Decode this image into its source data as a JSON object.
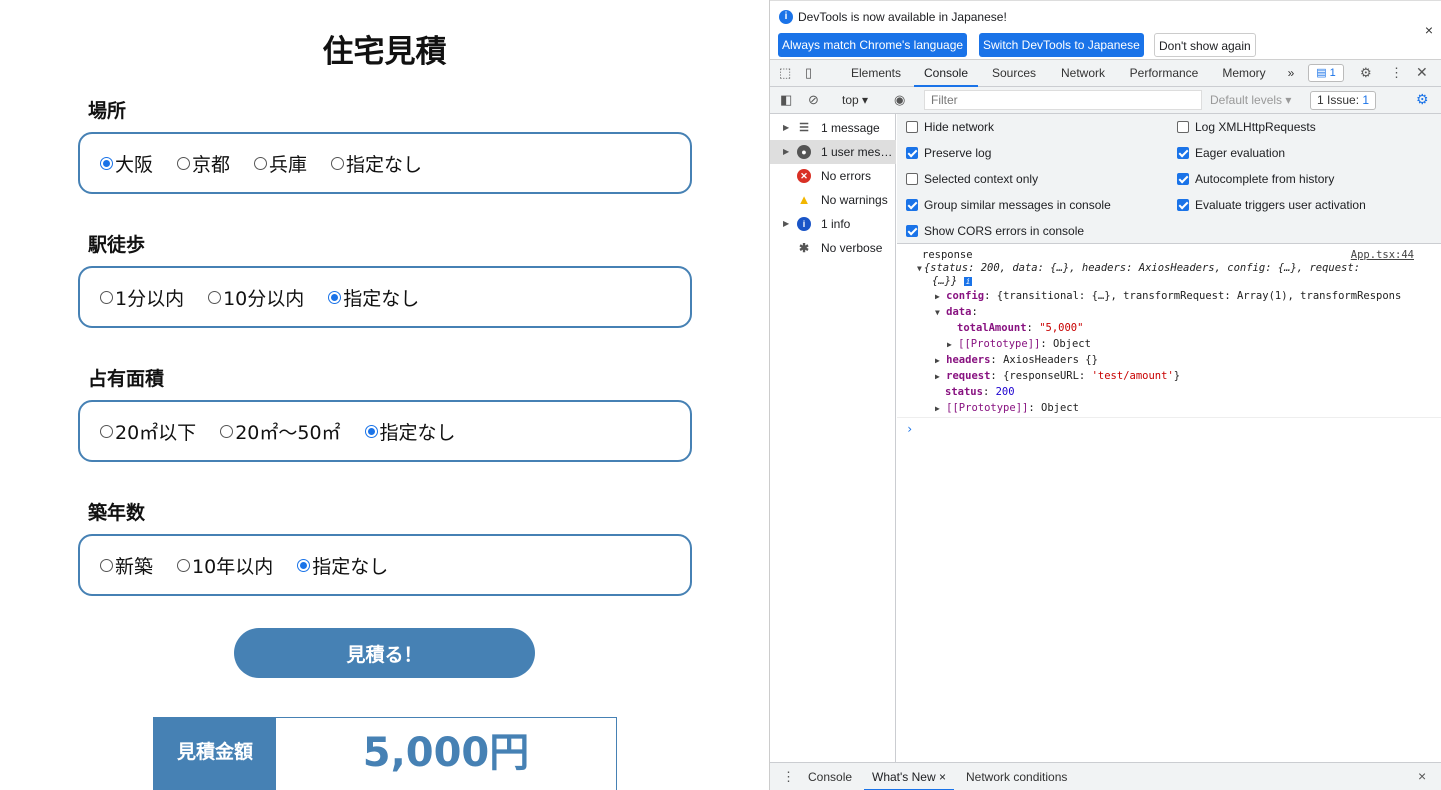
{
  "app": {
    "title": "住宅見積",
    "sections": [
      {
        "label": "場所",
        "options": [
          {
            "label": "大阪",
            "checked": true
          },
          {
            "label": "京都",
            "checked": false
          },
          {
            "label": "兵庫",
            "checked": false
          },
          {
            "label": "指定なし",
            "checked": false
          }
        ]
      },
      {
        "label": "駅徒歩",
        "options": [
          {
            "label": "1分以内",
            "checked": false
          },
          {
            "label": "10分以内",
            "checked": false
          },
          {
            "label": "指定なし",
            "checked": true
          }
        ]
      },
      {
        "label": "占有面積",
        "options": [
          {
            "label": "20㎡以下",
            "checked": false
          },
          {
            "label": "20㎡〜50㎡",
            "checked": false
          },
          {
            "label": "指定なし",
            "checked": true
          }
        ]
      },
      {
        "label": "築年数",
        "options": [
          {
            "label": "新築",
            "checked": false
          },
          {
            "label": "10年以内",
            "checked": false
          },
          {
            "label": "指定なし",
            "checked": true
          }
        ]
      }
    ],
    "estimate_button": "見積る！",
    "result_label": "見積金額",
    "result_value": "5,000円",
    "accent_color": "#4681b4"
  },
  "devtools": {
    "infobar": {
      "text": "DevTools is now available in Japanese!",
      "btn_match": "Always match Chrome's language",
      "btn_switch": "Switch DevTools to Japanese",
      "btn_dismiss": "Don't show again",
      "close": "×"
    },
    "tabs": [
      "Elements",
      "Console",
      "Sources",
      "Network",
      "Performance",
      "Memory"
    ],
    "more_tabs": "»",
    "issues_badge": "1",
    "filterbar": {
      "context": "top",
      "filter_placeholder": "Filter",
      "levels": "Default levels",
      "issues": "1 Issue:",
      "issues_count": "1"
    },
    "sidebar": [
      {
        "label": "1 message",
        "icon": "list-icon"
      },
      {
        "label": "1 user mes…",
        "icon": "user-icon"
      },
      {
        "label": "No errors",
        "icon": "error-icon"
      },
      {
        "label": "No warnings",
        "icon": "warning-icon"
      },
      {
        "label": "1 info",
        "icon": "info-icon"
      },
      {
        "label": "No verbose",
        "icon": "bug-icon"
      }
    ],
    "settings_left": [
      {
        "label": "Hide network",
        "checked": false
      },
      {
        "label": "Preserve log",
        "checked": true
      },
      {
        "label": "Selected context only",
        "checked": false
      },
      {
        "label": "Group similar messages in console",
        "checked": true
      },
      {
        "label": "Show CORS errors in console",
        "checked": true
      }
    ],
    "settings_right": [
      {
        "label": "Log XMLHttpRequests",
        "checked": false
      },
      {
        "label": "Eager evaluation",
        "checked": true
      },
      {
        "label": "Autocomplete from history",
        "checked": true
      },
      {
        "label": "Evaluate triggers user activation",
        "checked": true
      }
    ],
    "console": {
      "message": "response",
      "source": "App.tsx:44",
      "summary_1": "{status: 200, data: {…}, headers: AxiosHeaders, config: {…}, request:",
      "summary_2": "{…}}",
      "config_key": "config",
      "config_val": "{transitional: {…}, transformRequest: Array(1), transformRespons",
      "data_key": "data",
      "total_key": "totalAmount",
      "total_val": "\"5,000\"",
      "proto_key": "[[Prototype]]",
      "proto_val": "Object",
      "headers_key": "headers",
      "headers_val": "AxiosHeaders {}",
      "request_key": "request",
      "request_pre": "{responseURL: ",
      "request_str": "'test/amount'",
      "request_post": "}",
      "status_key": "status",
      "status_val": "200",
      "proto2_val": "Object",
      "prompt": "›"
    },
    "drawer": {
      "tabs": [
        "Console",
        "What's New",
        "Network conditions"
      ],
      "close": "×"
    }
  }
}
